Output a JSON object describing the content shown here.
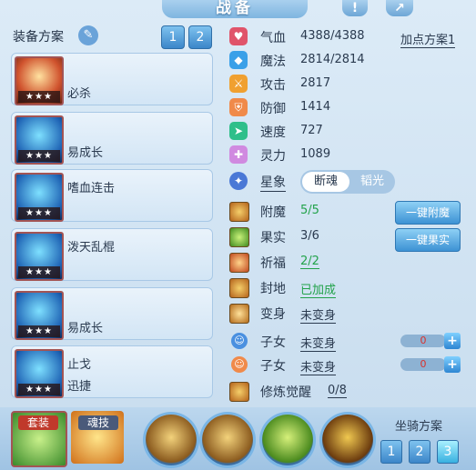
{
  "header": {
    "title": "战备"
  },
  "equip": {
    "title": "装备方案",
    "schemes": [
      "1",
      "2"
    ]
  },
  "slots": [
    {
      "name": "必杀",
      "stars": "★★★"
    },
    {
      "name": "易成长",
      "stars": "★★★"
    },
    {
      "name": "嗜血连击",
      "stars": "★★★"
    },
    {
      "name": "泼天乱棍",
      "stars": "★★★"
    },
    {
      "name": "易成长",
      "stars": "★★★"
    },
    {
      "name": "止戈",
      "name2": "迅捷",
      "stars": "★★★"
    }
  ],
  "stats": {
    "add_plan": "加点方案1",
    "items": [
      {
        "label": "气血",
        "value": "4388/4388",
        "icon": "heart-icon",
        "color": "#e0546a"
      },
      {
        "label": "魔法",
        "value": "2814/2814",
        "icon": "diamond-icon",
        "color": "#3aa0e8"
      },
      {
        "label": "攻击",
        "value": "2817",
        "icon": "attack-icon",
        "color": "#f0a030"
      },
      {
        "label": "防御",
        "value": "1414",
        "icon": "defense-icon",
        "color": "#f08a4a"
      },
      {
        "label": "速度",
        "value": "727",
        "icon": "speed-icon",
        "color": "#2fbf8a"
      },
      {
        "label": "灵力",
        "value": "1089",
        "icon": "spirit-icon",
        "color": "#d08ae0"
      }
    ],
    "star_label": "星象",
    "star_options": [
      "断魂",
      "韬光"
    ]
  },
  "rows": {
    "fumo": {
      "label": "附魔",
      "value": "5/5"
    },
    "guoshi": {
      "label": "果实",
      "value": "3/6"
    },
    "qifu": {
      "label": "祈福",
      "value": "2/2"
    },
    "fengdi": {
      "label": "封地",
      "value": "已加成"
    },
    "bianshen": {
      "label": "变身",
      "value": "未变身"
    },
    "zinv1": {
      "label": "子女",
      "value": "未变身",
      "bar": "0"
    },
    "zinv2": {
      "label": "子女",
      "value": "未变身",
      "bar": "0"
    },
    "xiulian": {
      "label": "修炼觉醒",
      "value": "0/8"
    }
  },
  "buttons": {
    "fumo": "一键附魔",
    "guoshi": "一键果实"
  },
  "bottom": {
    "tag1": "套装",
    "tag2": "魂技",
    "mount_title": "坐骑方案",
    "mounts": [
      "1",
      "2",
      "3"
    ]
  }
}
